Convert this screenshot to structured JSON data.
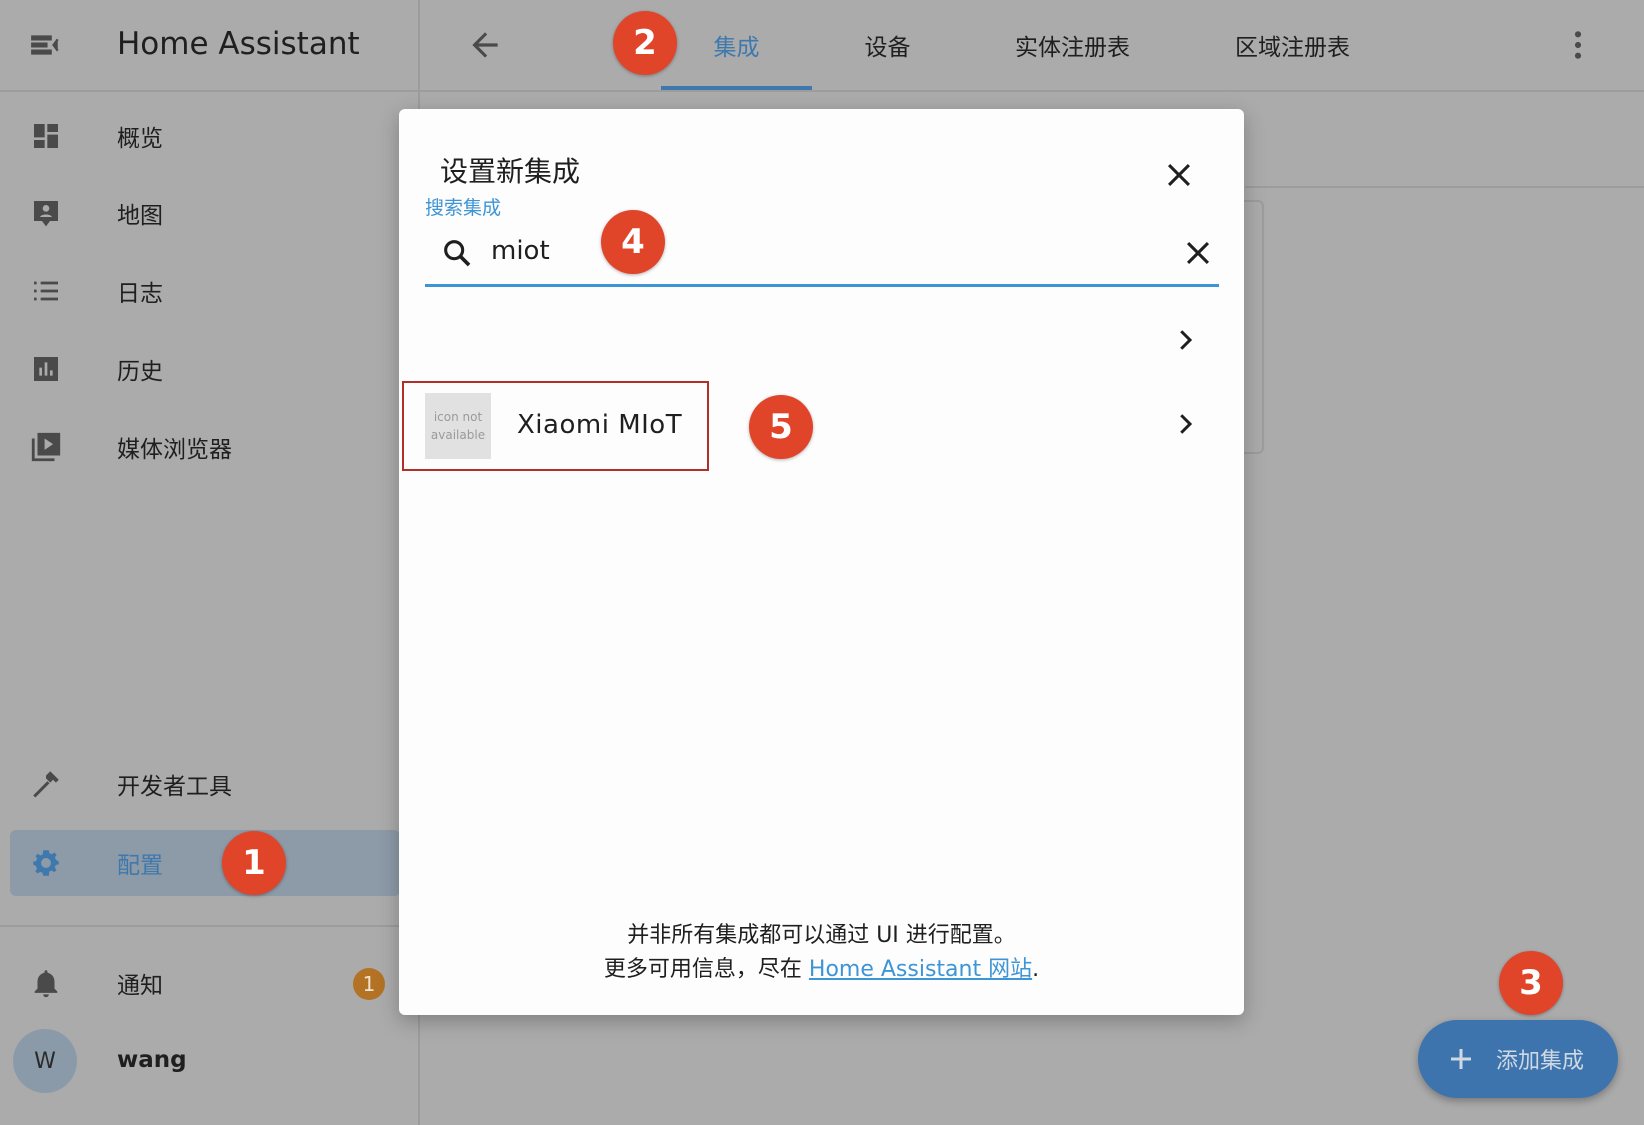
{
  "app": {
    "title": "Home Assistant"
  },
  "sidebar": {
    "items": [
      {
        "label": "概览",
        "icon": "dashboard-icon"
      },
      {
        "label": "地图",
        "icon": "map-icon"
      },
      {
        "label": "日志",
        "icon": "logbook-icon"
      },
      {
        "label": "历史",
        "icon": "history-icon"
      },
      {
        "label": "媒体浏览器",
        "icon": "media-browser-icon"
      }
    ],
    "bottom_items": [
      {
        "label": "开发者工具",
        "icon": "hammer-icon"
      },
      {
        "label": "配置",
        "icon": "gear-icon",
        "active": true
      }
    ],
    "notifications": {
      "label": "通知",
      "badge": "1"
    },
    "user": {
      "name": "wang",
      "initial": "W"
    }
  },
  "tabs": [
    {
      "label": "集成",
      "active": true
    },
    {
      "label": "设备"
    },
    {
      "label": "实体注册表"
    },
    {
      "label": "区域注册表"
    }
  ],
  "dialog": {
    "title": "设置新集成",
    "search_label": "搜索集成",
    "search_value": "miot",
    "result": {
      "name": "Xiaomi MIoT",
      "icon_placeholder_line1": "icon not",
      "icon_placeholder_line2": "available"
    },
    "footer_line1": "并非所有集成都可以通过 UI 进行配置。",
    "footer_line2_prefix": "更多可用信息，尽在 ",
    "footer_link": "Home Assistant 网站",
    "footer_line2_suffix": "."
  },
  "fab": {
    "label": "添加集成"
  },
  "markers": [
    "1",
    "2",
    "3",
    "4",
    "5"
  ],
  "colors": {
    "accent": "#3e95d6",
    "marker": "#e0452a",
    "fab": "#3e74ad",
    "badge": "#b37224"
  }
}
